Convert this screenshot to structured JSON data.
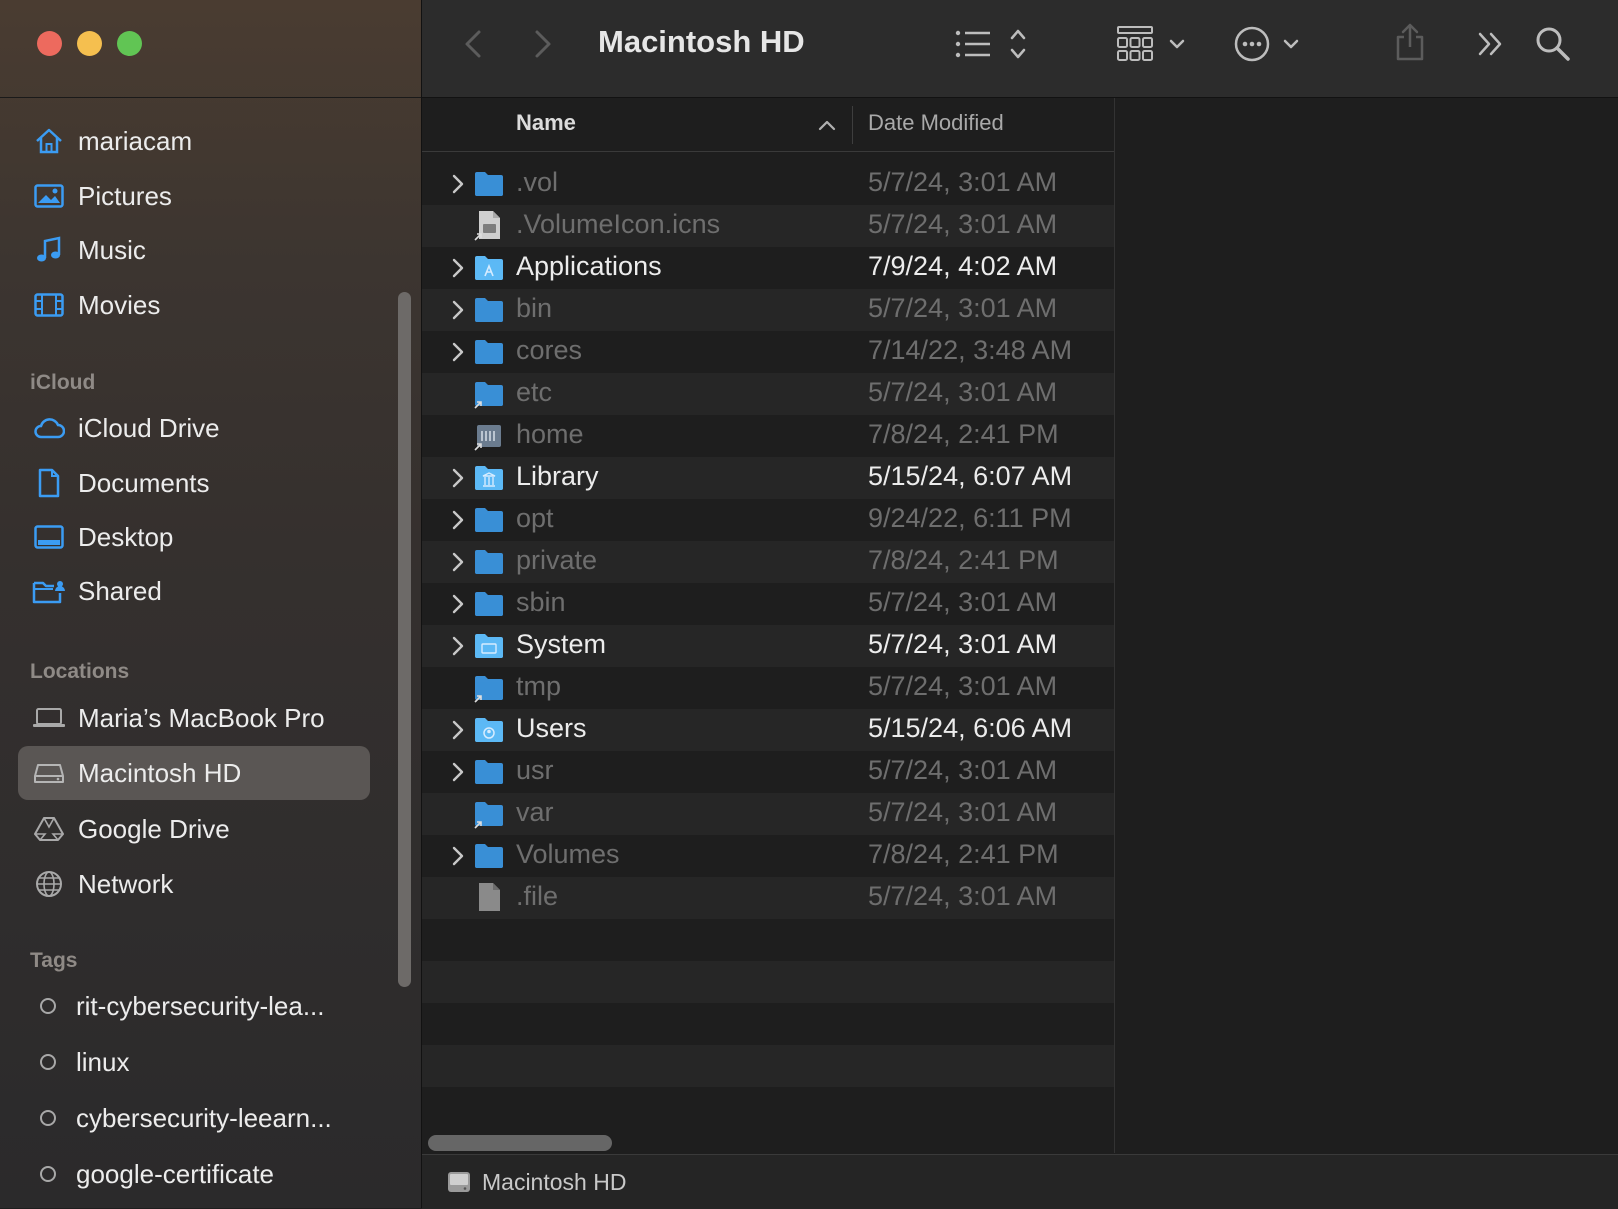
{
  "window": {
    "title": "Macintosh HD"
  },
  "sidebar": {
    "favorites": [
      {
        "label": "mariacam",
        "icon": "home-icon"
      },
      {
        "label": "Pictures",
        "icon": "pictures-icon"
      },
      {
        "label": "Music",
        "icon": "music-icon"
      },
      {
        "label": "Movies",
        "icon": "movies-icon"
      }
    ],
    "icloud_title": "iCloud",
    "icloud": [
      {
        "label": "iCloud Drive",
        "icon": "cloud-icon"
      },
      {
        "label": "Documents",
        "icon": "document-icon"
      },
      {
        "label": "Desktop",
        "icon": "desktop-icon"
      },
      {
        "label": "Shared",
        "icon": "shared-folder-icon"
      }
    ],
    "locations_title": "Locations",
    "locations": [
      {
        "label": "Maria’s MacBook Pro",
        "icon": "laptop-icon"
      },
      {
        "label": "Macintosh HD",
        "icon": "disk-icon",
        "selected": true
      },
      {
        "label": "Google Drive",
        "icon": "google-drive-icon"
      },
      {
        "label": "Network",
        "icon": "globe-icon"
      }
    ],
    "tags_title": "Tags",
    "tags": [
      {
        "label": "rit-cybersecurity-lea..."
      },
      {
        "label": "linux"
      },
      {
        "label": "cybersecurity-leearn..."
      },
      {
        "label": "google-certificate"
      }
    ]
  },
  "list": {
    "columns": {
      "name": "Name",
      "date": "Date Modified"
    },
    "sort": "ascending",
    "rows": [
      {
        "name": ".vol",
        "date": "5/7/24, 3:01 AM",
        "kind": "folder",
        "expandable": true,
        "bright": false
      },
      {
        "name": ".VolumeIcon.icns",
        "date": "5/7/24, 3:01 AM",
        "kind": "icns-file",
        "expandable": false,
        "bright": false
      },
      {
        "name": "Applications",
        "date": "7/9/24, 4:02 AM",
        "kind": "applications-folder",
        "expandable": true,
        "bright": true
      },
      {
        "name": "bin",
        "date": "5/7/24, 3:01 AM",
        "kind": "folder",
        "expandable": true,
        "bright": false
      },
      {
        "name": "cores",
        "date": "7/14/22, 3:48 AM",
        "kind": "folder",
        "expandable": true,
        "bright": false
      },
      {
        "name": "etc",
        "date": "5/7/24, 3:01 AM",
        "kind": "alias-folder",
        "expandable": false,
        "bright": false
      },
      {
        "name": "home",
        "date": "7/8/24, 2:41 PM",
        "kind": "home-alias",
        "expandable": false,
        "bright": false
      },
      {
        "name": "Library",
        "date": "5/15/24, 6:07 AM",
        "kind": "library-folder",
        "expandable": true,
        "bright": true
      },
      {
        "name": "opt",
        "date": "9/24/22, 6:11 PM",
        "kind": "folder",
        "expandable": true,
        "bright": false
      },
      {
        "name": "private",
        "date": "7/8/24, 2:41 PM",
        "kind": "folder",
        "expandable": true,
        "bright": false
      },
      {
        "name": "sbin",
        "date": "5/7/24, 3:01 AM",
        "kind": "folder",
        "expandable": true,
        "bright": false
      },
      {
        "name": "System",
        "date": "5/7/24, 3:01 AM",
        "kind": "system-folder",
        "expandable": true,
        "bright": true
      },
      {
        "name": "tmp",
        "date": "5/7/24, 3:01 AM",
        "kind": "alias-folder",
        "expandable": false,
        "bright": false
      },
      {
        "name": "Users",
        "date": "5/15/24, 6:06 AM",
        "kind": "users-folder",
        "expandable": true,
        "bright": true
      },
      {
        "name": "usr",
        "date": "5/7/24, 3:01 AM",
        "kind": "folder",
        "expandable": true,
        "bright": false
      },
      {
        "name": "var",
        "date": "5/7/24, 3:01 AM",
        "kind": "alias-folder",
        "expandable": false,
        "bright": false
      },
      {
        "name": "Volumes",
        "date": "7/8/24, 2:41 PM",
        "kind": "folder",
        "expandable": true,
        "bright": false
      },
      {
        "name": ".file",
        "date": "5/7/24, 3:01 AM",
        "kind": "file",
        "expandable": false,
        "bright": false
      }
    ]
  },
  "pathbar": {
    "label": "Macintosh HD",
    "icon": "disk-icon"
  },
  "colors": {
    "accent": "#3b9cf3",
    "folder": "#3a8fd6",
    "folder_bright": "#5cb8f5",
    "selected_bg": "#5a5654"
  }
}
